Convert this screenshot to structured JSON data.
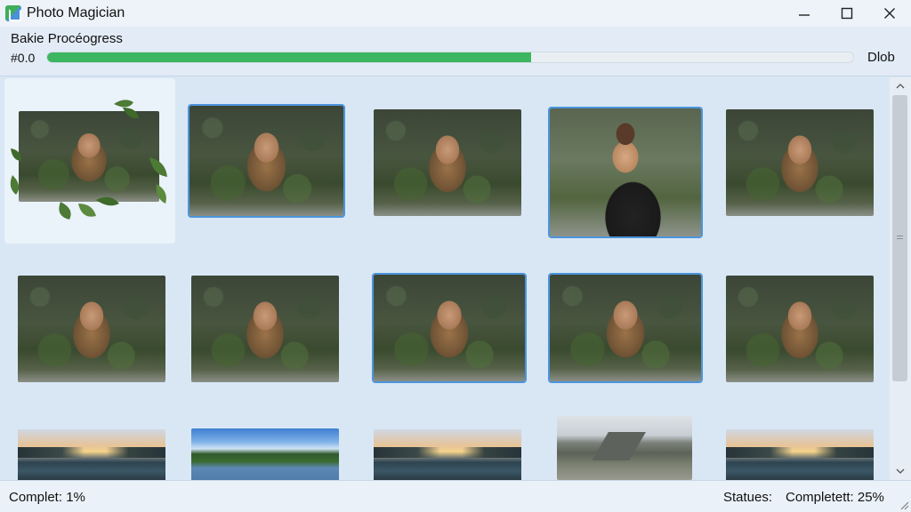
{
  "window": {
    "title": "Photo Magician",
    "icon": "photo-magician-app-icon",
    "controls": [
      "minimize-icon",
      "maximize-icon",
      "close-icon"
    ]
  },
  "progress": {
    "title": "Bakie Procéogress",
    "value_text": "#0.0",
    "fraction": 0.6,
    "action_label": "Dlob",
    "fill_color": "#3cb660"
  },
  "gallery": {
    "rows": [
      [
        {
          "kind": "portrait",
          "selected": false,
          "highlighted_tile": true,
          "leaf_frame": true
        },
        {
          "kind": "portrait",
          "selected": true
        },
        {
          "kind": "portrait",
          "selected": false
        },
        {
          "kind": "portrait-close",
          "selected": true
        },
        {
          "kind": "portrait",
          "selected": false
        }
      ],
      [
        {
          "kind": "portrait",
          "selected": false
        },
        {
          "kind": "portrait",
          "selected": false
        },
        {
          "kind": "portrait",
          "selected": true
        },
        {
          "kind": "portrait",
          "selected": true
        },
        {
          "kind": "portrait",
          "selected": false
        }
      ],
      [
        {
          "kind": "sunset-lake",
          "selected": false
        },
        {
          "kind": "forest-lake",
          "selected": false
        },
        {
          "kind": "sunset-lake",
          "selected": false
        },
        {
          "kind": "mountains",
          "selected": false
        },
        {
          "kind": "sunset-lake",
          "selected": false
        }
      ]
    ],
    "selection_color": "#4b95dc"
  },
  "scrollbar": {
    "up_icon": "chevron-up-icon",
    "down_icon": "chevron-down-icon"
  },
  "status": {
    "left_text": "Complet: 1%",
    "label": "Statues:",
    "value": "Completett: 25%"
  }
}
